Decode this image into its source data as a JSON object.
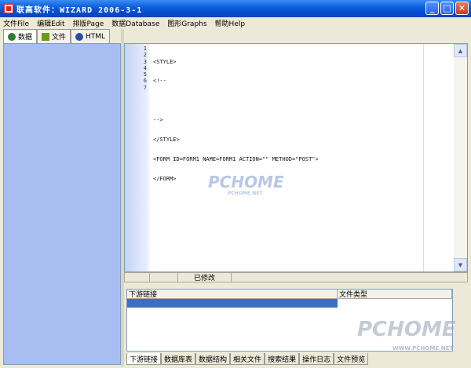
{
  "window": {
    "title": "联高软件：WIZARD 2006-3-1",
    "buttons": [
      "minimize",
      "maximize",
      "close"
    ]
  },
  "menu": [
    "文件File",
    "编辑Edit",
    "排版Page",
    "数据Database",
    "图形Graphs",
    "帮助Help"
  ],
  "left_tabs": [
    {
      "label": "数据",
      "icon": "database-icon",
      "color": "#2e7d32"
    },
    {
      "label": "文件",
      "icon": "file-icon",
      "color": "#6a9a1f"
    },
    {
      "label": "HTML",
      "icon": "html-globe-icon",
      "color": "#2a4fa0"
    }
  ],
  "editor": {
    "line_numbers": [
      "1",
      "2",
      "3",
      "4",
      "5",
      "6",
      "7"
    ],
    "lines": [
      "<STYLE>",
      "<!--",
      "",
      "-->",
      "</STYLE>",
      "<FORM ID=FORM1 NAME=FORM1 ACTION=\"\" METHOD=\"POST\">",
      "</FORM>"
    ]
  },
  "status": {
    "modified": "已修改"
  },
  "grid": {
    "columns": [
      "下游链接",
      "文件类型"
    ]
  },
  "bottom_tabs": [
    "下游链接",
    "数据库表",
    "数据结构",
    "相关文件",
    "搜索结果",
    "操作日志",
    "文件预览"
  ],
  "watermarks": {
    "center": "PCHOME",
    "center_sub": "PCHOME.NET",
    "corner": "PCHOME",
    "corner_sub": "WWW.PCHOME.NET"
  },
  "colors": {
    "titlebar": "#0a5bd8",
    "left_panel": "#a8bef2",
    "selection": "#3b6fc4"
  }
}
